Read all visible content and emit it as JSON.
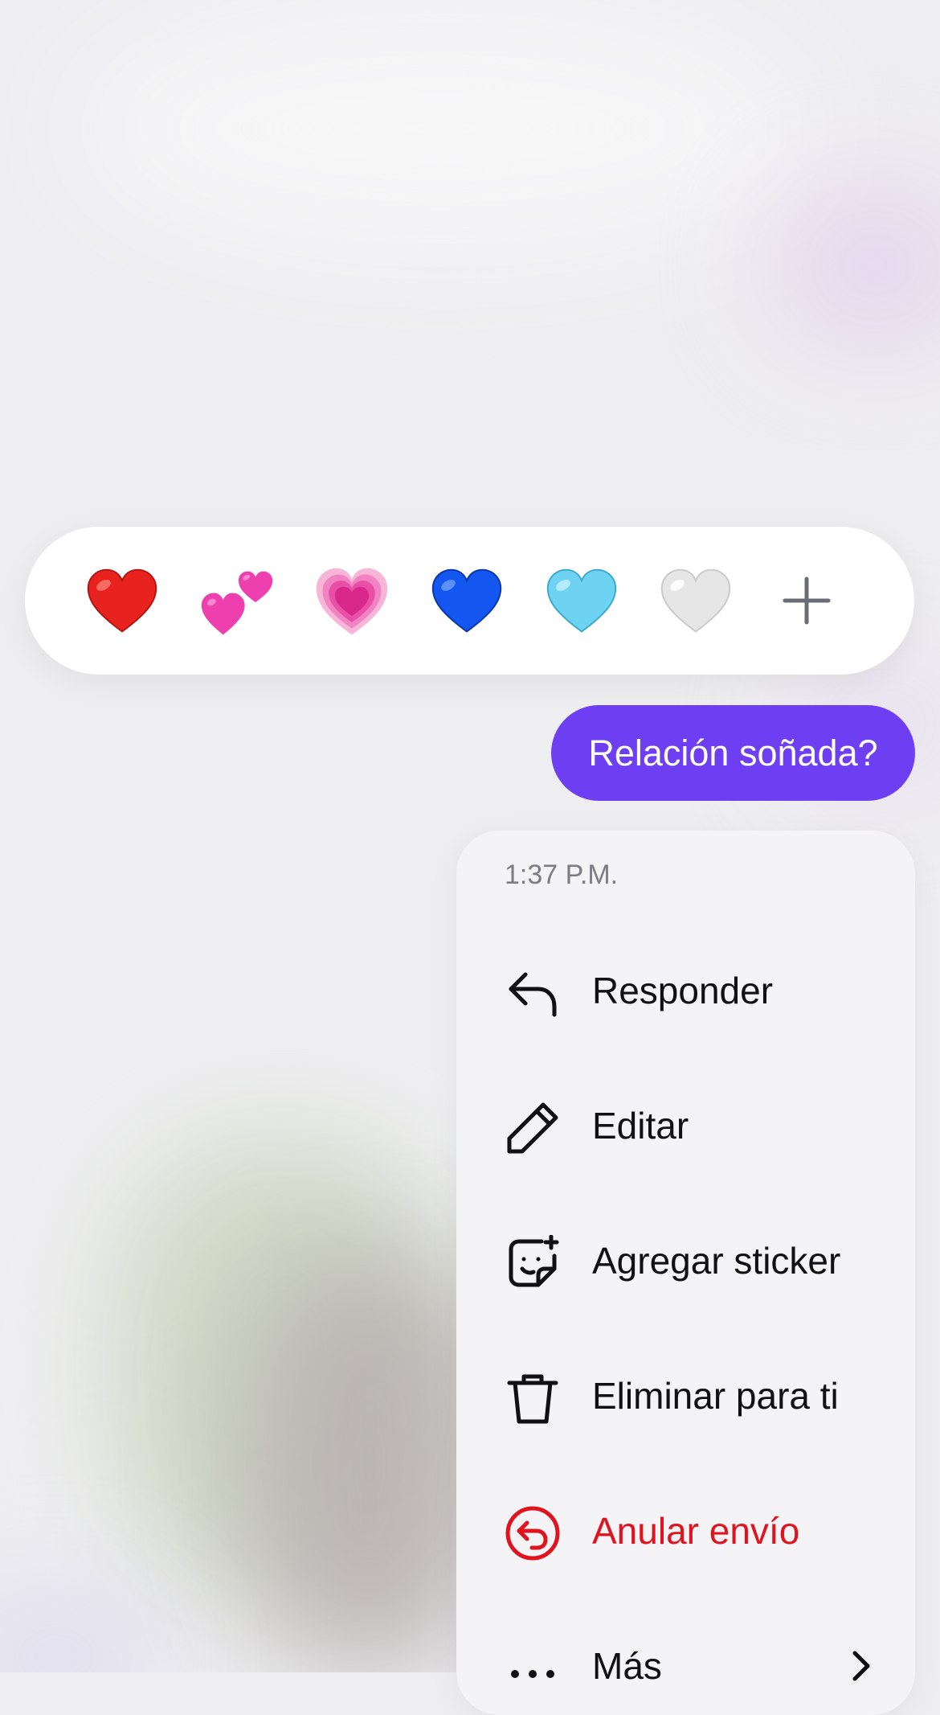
{
  "reactions": {
    "items": [
      {
        "name": "red-heart",
        "color": "#e8231f"
      },
      {
        "name": "two-hearts",
        "color": "#ee3fae"
      },
      {
        "name": "growing-heart",
        "color": "#ee5fb0"
      },
      {
        "name": "blue-heart",
        "color": "#1357f0"
      },
      {
        "name": "light-blue-heart",
        "color": "#6ed3f2"
      },
      {
        "name": "white-heart",
        "color": "#e2e2e2"
      }
    ],
    "more_icon": "plus-icon"
  },
  "message": {
    "text": "Relación soñada?",
    "bubble_color": "#6e3ff2"
  },
  "menu": {
    "timestamp": "1:37 P.M.",
    "items": [
      {
        "label": "Responder",
        "icon": "reply-icon"
      },
      {
        "label": "Editar",
        "icon": "pencil-icon"
      },
      {
        "label": "Agregar sticker",
        "icon": "add-sticker-icon"
      },
      {
        "label": "Eliminar para ti",
        "icon": "trash-icon"
      },
      {
        "label": "Anular envío",
        "icon": "unsend-icon",
        "color": "#e0141e"
      },
      {
        "label": "Más",
        "icon": "more-dots-icon",
        "trailing_icon": "chevron-right-icon"
      }
    ]
  }
}
